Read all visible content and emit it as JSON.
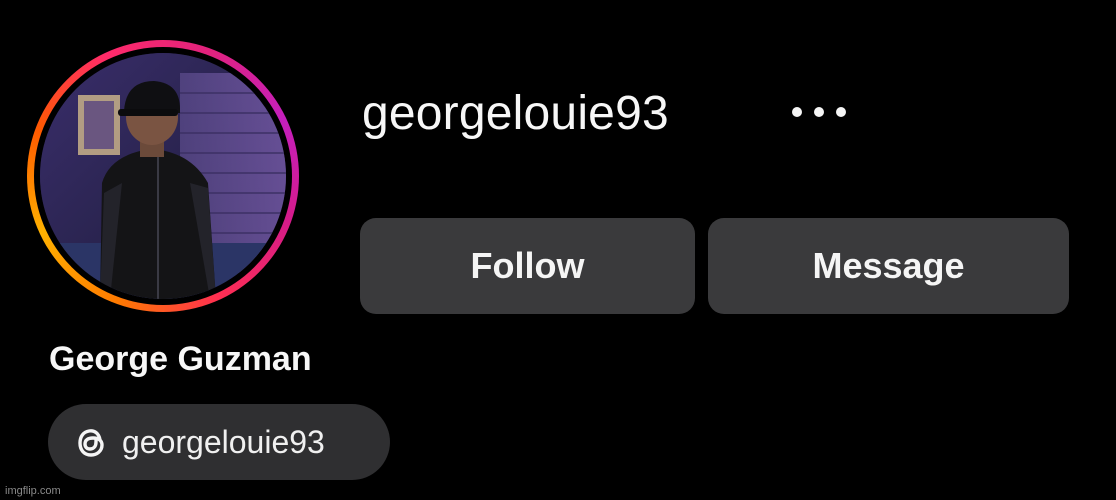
{
  "profile": {
    "username": "georgelouie93",
    "display_name": "George Guzman",
    "more_icon": "more-horizontal-icon",
    "avatar_icon": "profile-photo"
  },
  "actions": {
    "follow_label": "Follow",
    "message_label": "Message"
  },
  "threads_link": {
    "icon": "threads-icon",
    "handle": "georgelouie93"
  },
  "watermark": {
    "text": "imgflip.com"
  },
  "colors": {
    "background": "#000000",
    "button_background": "#3a3a3c",
    "pill_background": "#2f2f31",
    "text": "#f5f5f5",
    "story_ring_start": "#ffb100",
    "story_ring_end": "#c41fbd"
  }
}
